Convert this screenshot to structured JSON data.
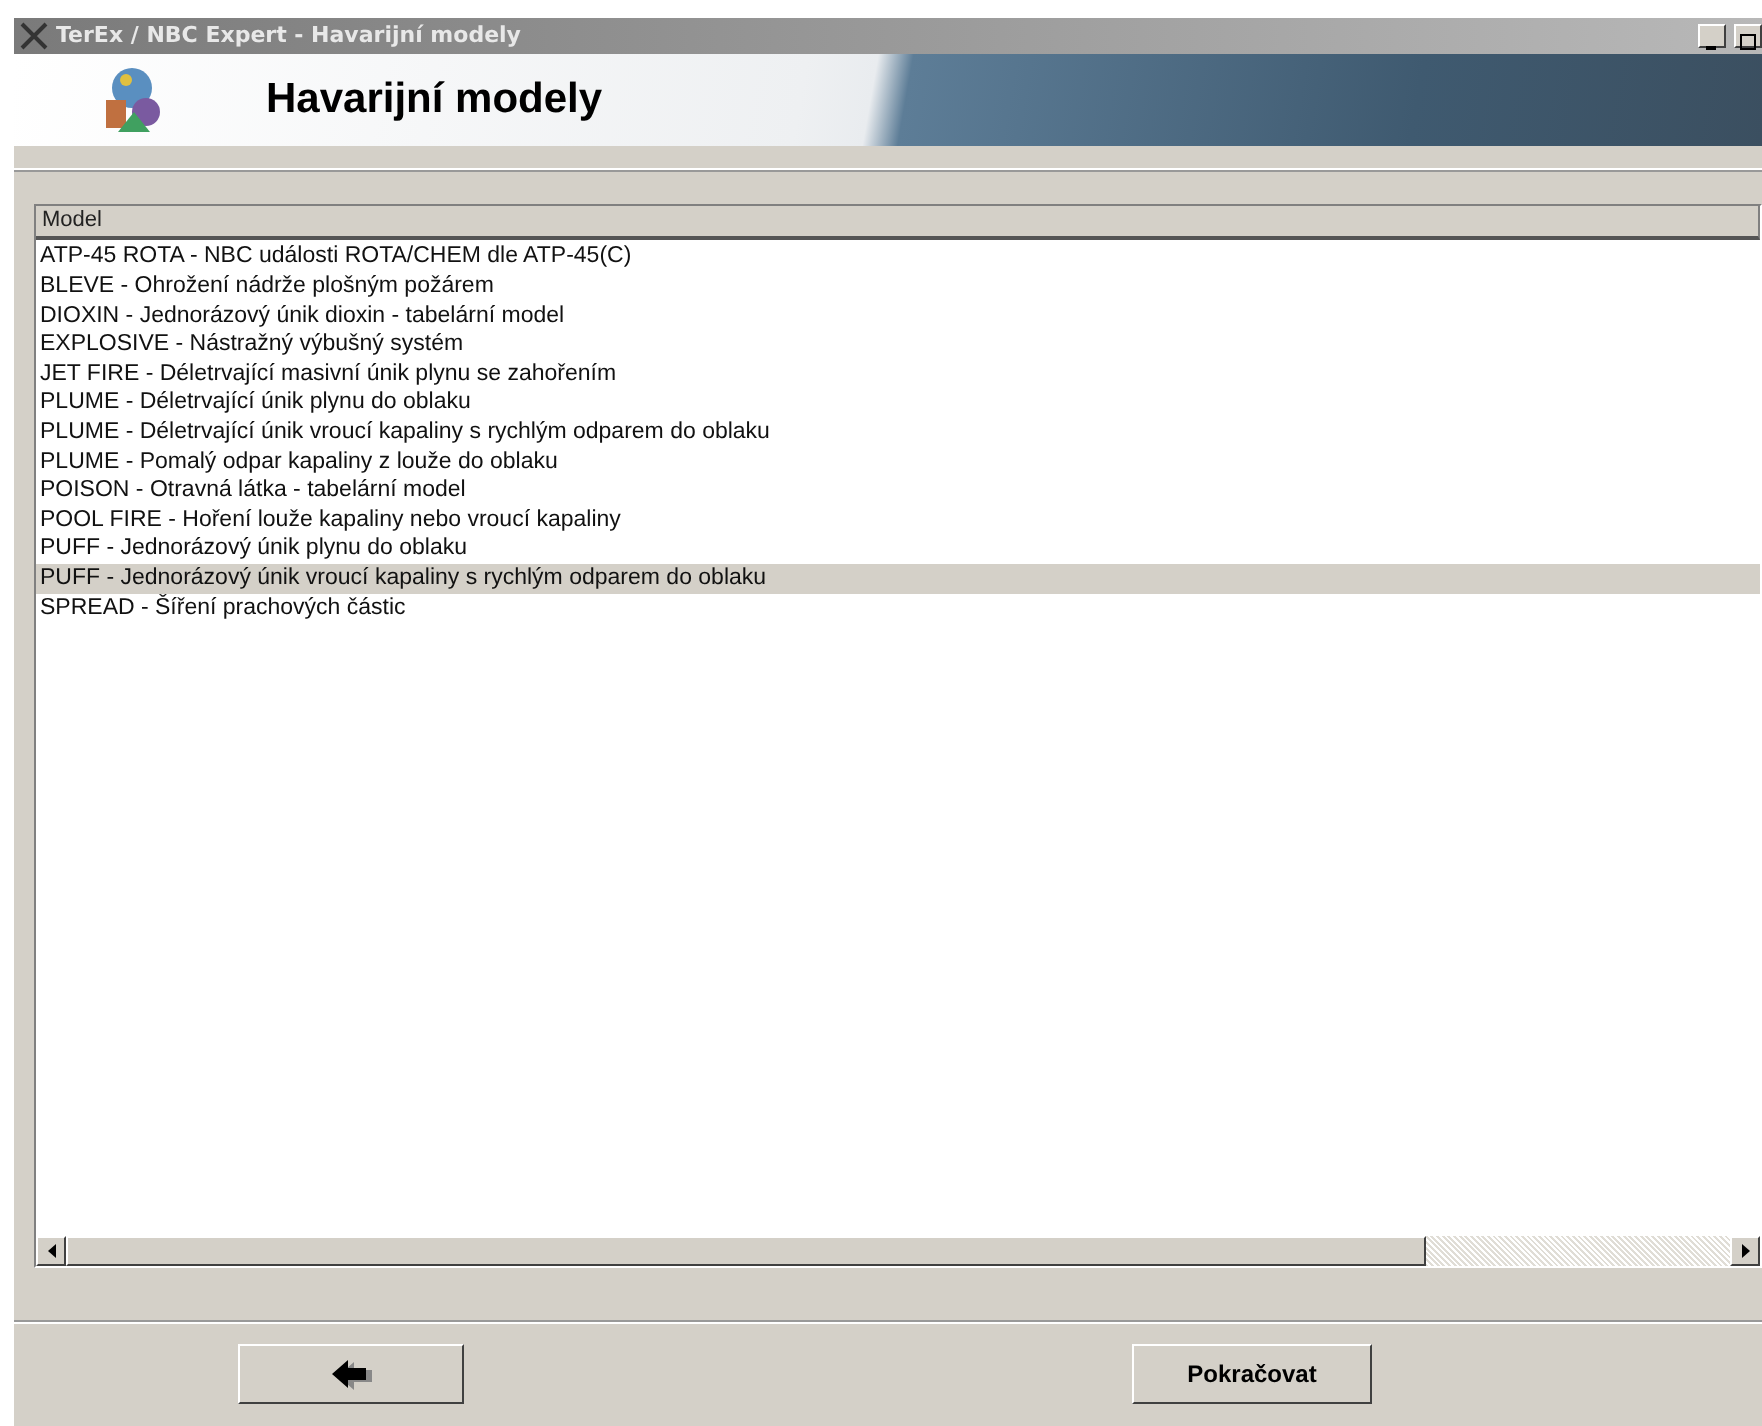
{
  "window": {
    "title": "TerEx / NBC Expert  - Havarijní modely"
  },
  "header": {
    "title": "Havarijní modely"
  },
  "table": {
    "columns": [
      "Model"
    ],
    "rows": [
      {
        "label": "ATP-45 ROTA - NBC události ROTA/CHEM dle ATP-45(C)",
        "selected": false
      },
      {
        "label": "BLEVE - Ohrožení nádrže plošným požárem",
        "selected": false
      },
      {
        "label": "DIOXIN - Jednorázový únik dioxin - tabelární model",
        "selected": false
      },
      {
        "label": "EXPLOSIVE - Nástražný výbušný systém",
        "selected": false
      },
      {
        "label": "JET FIRE - Déletrvající masivní únik plynu se zahořením",
        "selected": false
      },
      {
        "label": "PLUME - Déletrvající únik plynu do oblaku",
        "selected": false
      },
      {
        "label": "PLUME - Déletrvající únik vroucí kapaliny s rychlým odparem do oblaku",
        "selected": false
      },
      {
        "label": "PLUME - Pomalý odpar kapaliny z louže do oblaku",
        "selected": false
      },
      {
        "label": "POISON - Otravná látka - tabelární model",
        "selected": false
      },
      {
        "label": "POOL FIRE - Hoření louže kapaliny nebo vroucí kapaliny",
        "selected": false
      },
      {
        "label": "PUFF - Jednorázový únik plynu do oblaku",
        "selected": false
      },
      {
        "label": "PUFF - Jednorázový únik vroucí kapaliny s rychlým odparem do oblaku",
        "selected": true
      },
      {
        "label": "SPREAD - Šíření prachových částic",
        "selected": false
      }
    ]
  },
  "buttons": {
    "next": "Pokračovat"
  }
}
